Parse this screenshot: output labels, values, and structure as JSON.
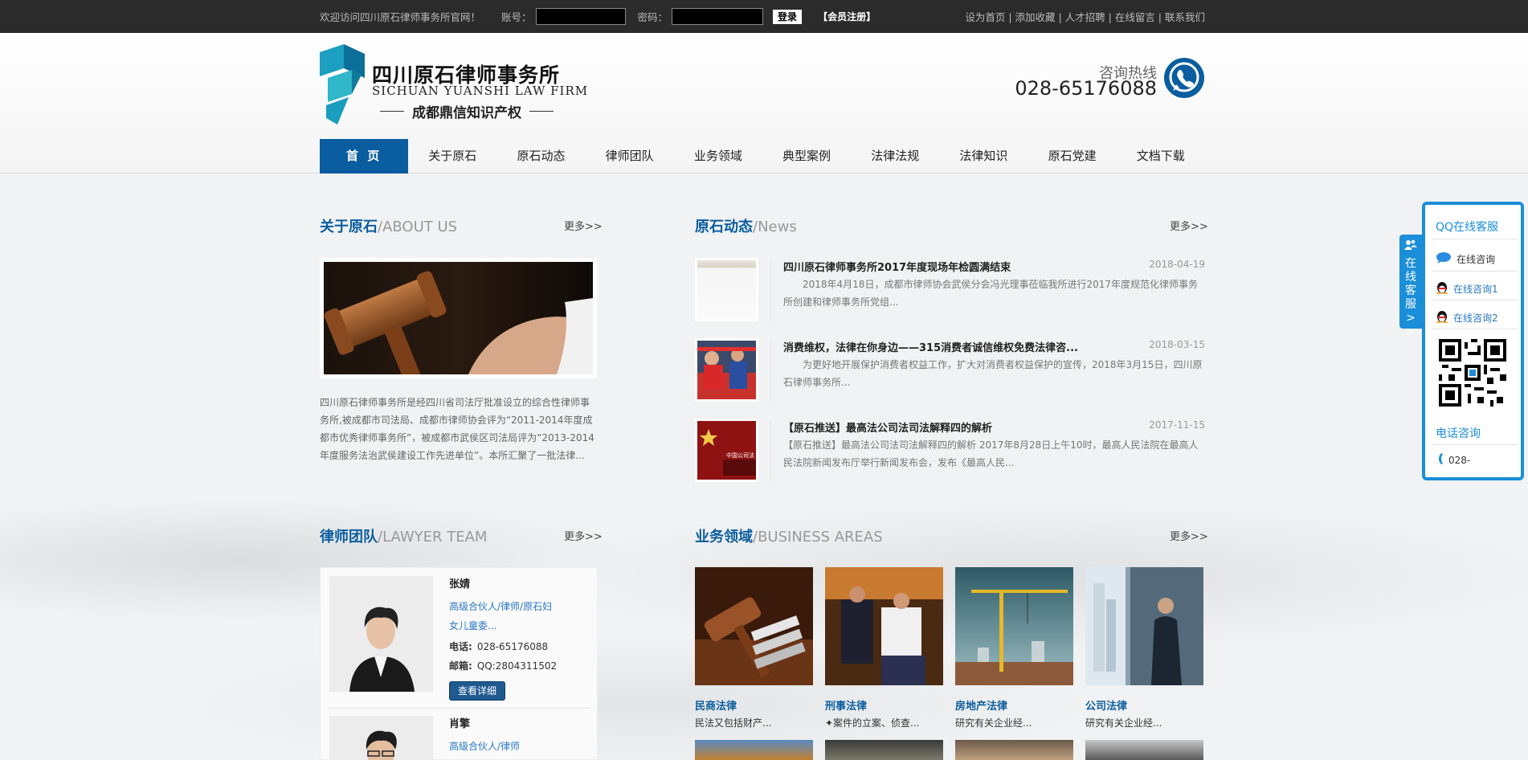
{
  "topbar": {
    "welcome": "欢迎访问四川原石律师事务所官网！",
    "account_label": "账号：",
    "password_label": "密码：",
    "login_button": "登录",
    "register_link": "【会员注册】",
    "right_links": "设为首页 | 添加收藏 | 人才招聘 | 在线留言 | 联系我们"
  },
  "logo": {
    "name_cn": "四川原石律师事务所",
    "name_en": "SICHUAN YUANSHI LAW FIRM",
    "sub": "成都鼎信知识产权"
  },
  "hotline": {
    "label": "咨询热线",
    "number": "028-65176088"
  },
  "nav": [
    "首 页",
    "关于原石",
    "原石动态",
    "律师团队",
    "业务领域",
    "典型案例",
    "法律法规",
    "法律知识",
    "原石党建",
    "文档下载"
  ],
  "about": {
    "title_cn": "关于原石",
    "title_en": "/ABOUT US",
    "more": "更多>>",
    "text": " 四川原石律师事务所是经四川省司法厅批准设立的综合性律师事务所,被成都市司法局、成都市律师协会评为“2011-2014年度成都市优秀律师事务所”，被成都市武侯区司法局评为“2013-2014年度服务法治武侯建设工作先进单位”。本所汇聚了一批法律..."
  },
  "news": {
    "title_cn": "原石动态",
    "title_en": "/News",
    "more": "更多>>",
    "items": [
      {
        "title": "四川原石律师事务所2017年度现场年检圆满结束",
        "date": "2018-04-19",
        "excerpt": "　　2018年4月18日，成都市律师协会武侯分会冯光理事莅临我所进行2017年度规范化律师事务所创建和律师事务所党组..."
      },
      {
        "title": "消费维权，法律在你身边——315消费者诚信维权免费法律咨...",
        "date": "2018-03-15",
        "excerpt": "　　为更好地开展保护消费者权益工作，扩大对消费者权益保护的宣传，2018年3月15日，四川原石律师事务所..."
      },
      {
        "title": "【原石推送】最高法公司法司法解释四的解析",
        "date": "2017-11-15",
        "excerpt": "【原石推送】最高法公司法司法解释四的解析 2017年8月28日上午10时，最高人民法院在最高人民法院新闻发布厅举行新闻发布会，发布《最高人民..."
      }
    ],
    "thumb3_text": "中国公司法"
  },
  "team": {
    "title_cn": "律师团队",
    "title_en": "/LAWYER TEAM",
    "more": "更多>>",
    "lawyers": [
      {
        "name": "张婧",
        "title": "高级合伙人/律师/原石妇女儿童委...",
        "phone_label": "电话:",
        "phone": "028-65176088",
        "mail_label": "邮箱:",
        "mail": "QQ:2804311502",
        "button": "查看详细"
      },
      {
        "name": "肖擎",
        "title": "高级合伙人/律师"
      }
    ]
  },
  "business": {
    "title_cn": "业务领域",
    "title_en": "/BUSINESS AREAS",
    "more": "更多>>",
    "items": [
      {
        "name": "民商法律",
        "desc": "民法又包括财产..."
      },
      {
        "name": "刑事法律",
        "desc": "✦案件的立案、侦查..."
      },
      {
        "name": "房地产法律",
        "desc": "研究有关企业经..."
      },
      {
        "name": "公司法律",
        "desc": "研究有关企业经..."
      }
    ]
  },
  "float_service": {
    "tab": "在线客服>>",
    "title": "QQ在线客服",
    "online": "在线咨询",
    "qq1": "在线咨询1",
    "qq2": "在线咨询2",
    "tel_title": "电话咨询",
    "tel": "028-"
  },
  "colors": {
    "brand": "#0a5d9e",
    "topbar": "#2b2b2b",
    "float": "#1a8ed8"
  }
}
